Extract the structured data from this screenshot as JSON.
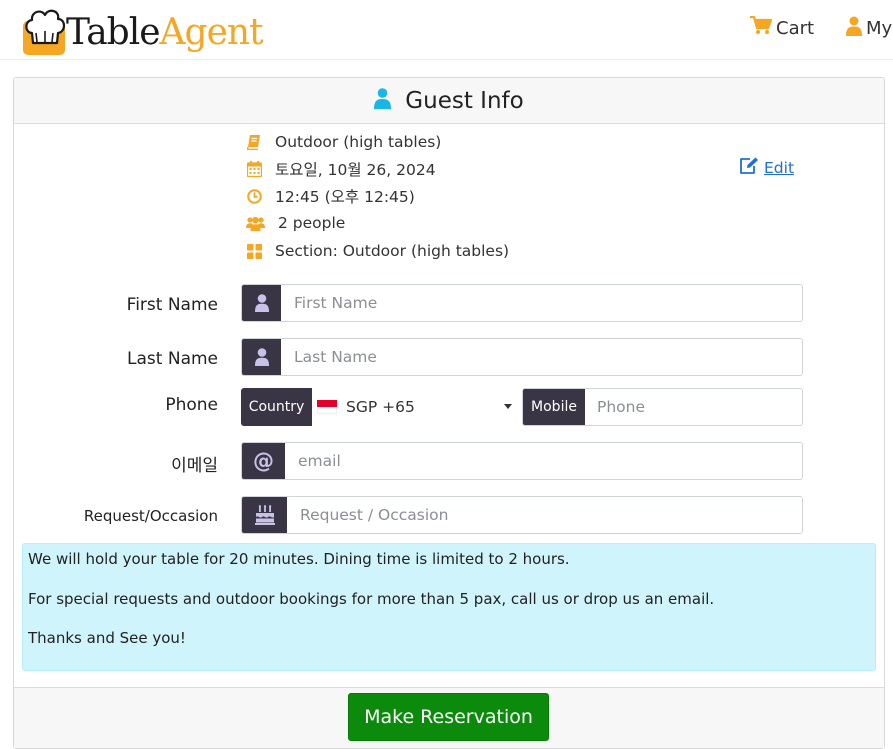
{
  "brand": {
    "name_part1": "Table",
    "name_part2": "Agent",
    "primary_color": "#f5a623",
    "addon_color": "#3a3545",
    "button_color": "#0b8a0b",
    "notice_color": "#cff4fc"
  },
  "nav": {
    "cart_label": "Cart",
    "account_label": "My"
  },
  "card": {
    "title": "Guest Info",
    "title_icon": "user-icon"
  },
  "booking": {
    "area": "Outdoor (high tables)",
    "date": "토요일, 10월 26, 2024",
    "time": "12:45 (오후 12:45)",
    "party": "2 people",
    "section": "Section: Outdoor (high tables)",
    "edit_label": "Edit"
  },
  "form": {
    "first_name": {
      "label": "First Name",
      "placeholder": "First Name",
      "value": ""
    },
    "last_name": {
      "label": "Last Name",
      "placeholder": "Last Name",
      "value": ""
    },
    "phone": {
      "label": "Phone",
      "country_addon": "Country",
      "country_value": "SGP +65",
      "mobile_addon": "Mobile",
      "placeholder": "Phone",
      "value": ""
    },
    "email": {
      "label": "이메일",
      "placeholder": "email",
      "value": ""
    },
    "request": {
      "label": "Request/Occasion",
      "placeholder": "Request / Occasion",
      "value": ""
    }
  },
  "notice": {
    "line1": "We will hold your table for 20 minutes. Dining time is limited to 2 hours.",
    "line2": "For special requests and outdoor bookings for more than 5 pax, call us or drop us an email.",
    "line3": "Thanks and See you!"
  },
  "actions": {
    "submit_label": "Make Reservation"
  }
}
